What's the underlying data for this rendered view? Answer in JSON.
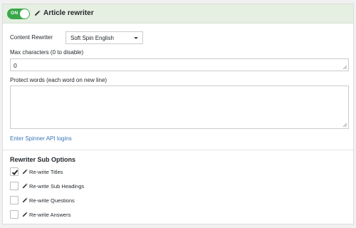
{
  "header": {
    "toggle_label": "ON",
    "title": "Article rewriter"
  },
  "content_rewriter": {
    "label": "Content Rewriter",
    "selected": "Soft Spin English"
  },
  "max_characters": {
    "label": "Max characters (0 to disable)",
    "value": "0"
  },
  "protect_words": {
    "label": "Protect words (each word on new line)",
    "value": ""
  },
  "api_link": "Enter Spinner API logins",
  "sub_options": {
    "heading": "Rewriter Sub Options",
    "items": [
      {
        "label": "Re-write Titles",
        "checked": true
      },
      {
        "label": "Re-write Sub Headings",
        "checked": false
      },
      {
        "label": "Re-write Questions",
        "checked": false
      },
      {
        "label": "Re-write Answers",
        "checked": false
      }
    ]
  },
  "colors": {
    "toggle_on": "#3aa84a",
    "header_bg": "#e5efe2",
    "link": "#3a76b7"
  }
}
